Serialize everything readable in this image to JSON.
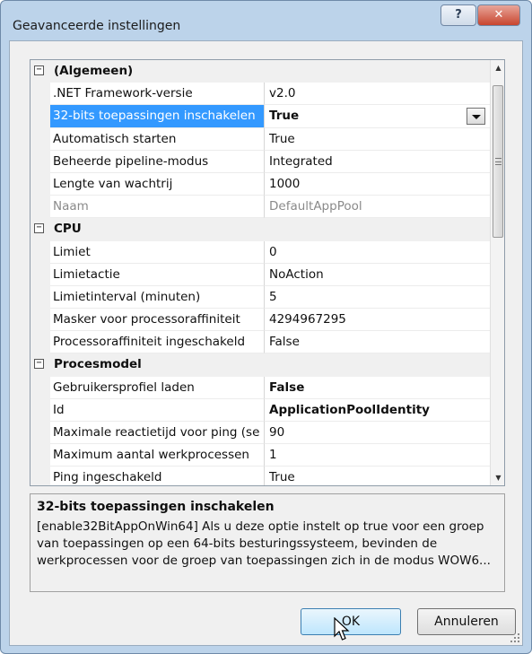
{
  "window": {
    "title": "Geavanceerde instellingen",
    "help_label": "?",
    "close_label": "✕"
  },
  "categories": [
    {
      "label": "(Algemeen)",
      "expander": "−",
      "properties": [
        {
          "name": ".NET Framework-versie",
          "value": "v2.0"
        },
        {
          "name": "32-bits toepassingen inschakelen",
          "value": "True",
          "selected": true,
          "bold": true
        },
        {
          "name": "Automatisch starten",
          "value": "True"
        },
        {
          "name": "Beheerde pipeline-modus",
          "value": "Integrated"
        },
        {
          "name": "Lengte van wachtrij",
          "value": "1000"
        },
        {
          "name": "Naam",
          "value": "DefaultAppPool",
          "readonly": true
        }
      ]
    },
    {
      "label": "CPU",
      "expander": "−",
      "properties": [
        {
          "name": "Limiet",
          "value": "0"
        },
        {
          "name": "Limietactie",
          "value": "NoAction"
        },
        {
          "name": "Limietinterval (minuten)",
          "value": "5"
        },
        {
          "name": "Masker voor processoraffiniteit",
          "value": "4294967295"
        },
        {
          "name": "Processoraffiniteit ingeschakeld",
          "value": "False"
        }
      ]
    },
    {
      "label": "Procesmodel",
      "expander": "−",
      "properties": [
        {
          "name": "Gebruikersprofiel laden",
          "value": "False",
          "bold": true
        },
        {
          "name": "Id",
          "value": "ApplicationPoolIdentity",
          "bold": true
        },
        {
          "name": "Maximale reactietijd voor ping (se",
          "value": "90"
        },
        {
          "name": "Maximum aantal werkprocessen",
          "value": "1"
        },
        {
          "name": "Ping ingeschakeld",
          "value": "True"
        }
      ]
    }
  ],
  "description": {
    "title": "32-bits toepassingen inschakelen",
    "text": "[enable32BitAppOnWin64] Als u deze optie instelt op true voor een groep van toepassingen op een 64-bits besturingssysteem, bevinden de werkprocessen voor de groep van toepassingen zich in de modus WOW6..."
  },
  "buttons": {
    "ok": "OK",
    "cancel": "Annuleren"
  },
  "scrollbar": {
    "up_arrow": "▲",
    "down_arrow": "▼"
  }
}
